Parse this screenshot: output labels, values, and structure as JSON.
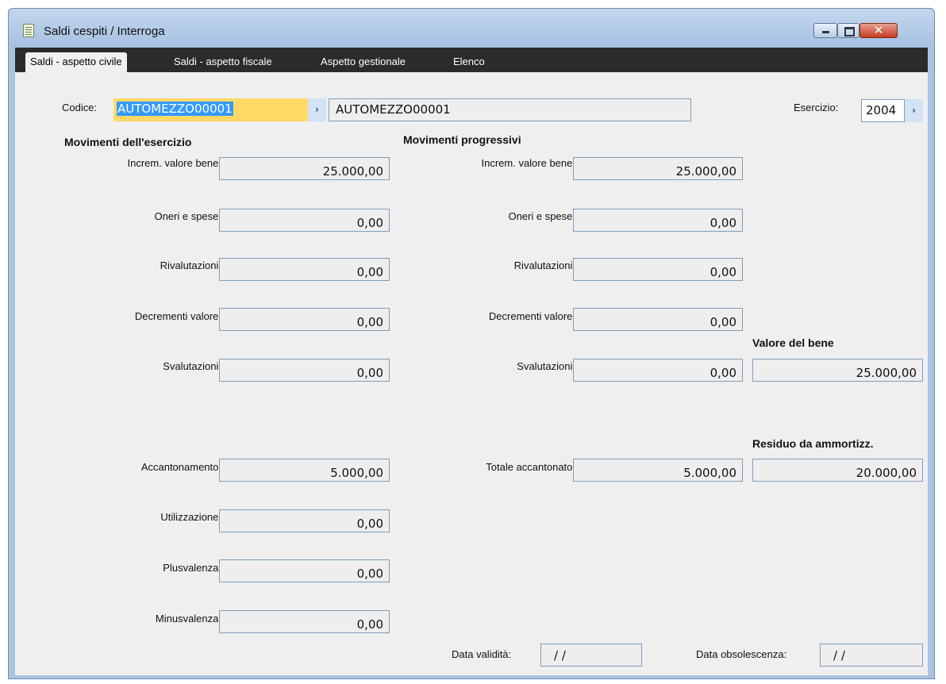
{
  "window": {
    "title": "Saldi cespiti / Interroga",
    "close_glyph": "✕"
  },
  "tabs": [
    {
      "label": "Saldi - aspetto civile",
      "active": true
    },
    {
      "label": "Saldi - aspetto fiscale",
      "active": false
    },
    {
      "label": "Aspetto gestionale",
      "active": false
    },
    {
      "label": "Elenco",
      "active": false
    }
  ],
  "header": {
    "codice_label": "Codice:",
    "codice_value": "AUTOMEZZO00001",
    "descrizione_value": "AUTOMEZZO00001",
    "esercizio_label": "Esercizio:",
    "esercizio_value": "2004",
    "zoom_glyph": "›"
  },
  "esercizio": {
    "title": "Movimenti dell'esercizio",
    "rows": [
      {
        "label": "Increm. valore bene:",
        "value": "25.000,00"
      },
      {
        "label": "Oneri e spese:",
        "value": "0,00"
      },
      {
        "label": "Rivalutazioni:",
        "value": "0,00"
      },
      {
        "label": "Decrementi valore:",
        "value": "0,00"
      },
      {
        "label": "Svalutazioni:",
        "value": "0,00"
      },
      {
        "label": "Accantonamento:",
        "value": "5.000,00"
      },
      {
        "label": "Utilizzazione:",
        "value": "0,00"
      },
      {
        "label": "Plusvalenza:",
        "value": "0,00"
      },
      {
        "label": "Minusvalenza:",
        "value": "0,00"
      }
    ]
  },
  "progressivi": {
    "title": "Movimenti progressivi",
    "rows": [
      {
        "label": "Increm. valore bene:",
        "value": "25.000,00"
      },
      {
        "label": "Oneri e spese:",
        "value": "0,00"
      },
      {
        "label": "Rivalutazioni:",
        "value": "0,00"
      },
      {
        "label": "Decrementi valore:",
        "value": "0,00"
      },
      {
        "label": "Svalutazioni:",
        "value": "0,00"
      },
      {
        "label": "Totale accantonato:",
        "value": "5.000,00"
      }
    ]
  },
  "valore_bene": {
    "title": "Valore del bene",
    "value": "25.000,00"
  },
  "residuo": {
    "title": "Residuo da ammortizz.",
    "value": "20.000,00"
  },
  "dates": {
    "validita_label": "Data validità:",
    "validita_value": "/ /",
    "obsolescenza_label": "Data obsolescenza:",
    "obsolescenza_value": "/ /"
  }
}
